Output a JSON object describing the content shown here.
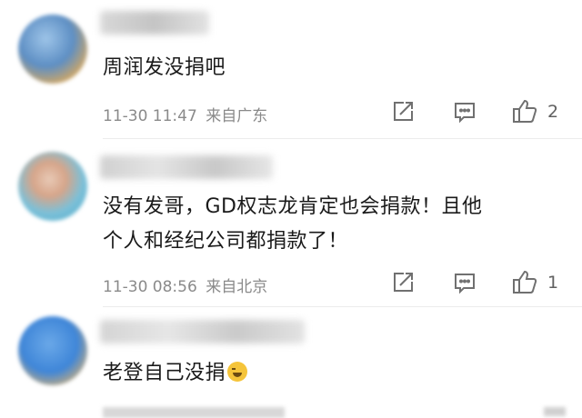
{
  "comments": [
    {
      "text": "周润发没捐吧",
      "time": "11-30 11:47",
      "location": "来自广东",
      "likes": "2"
    },
    {
      "text_line1": "没有发哥，GD权志龙肯定也会捐款！且他",
      "text_line2": "个人和经纪公司都捐款了！",
      "time": "11-30 08:56",
      "location": "来自北京",
      "likes": "1"
    },
    {
      "text": "老登自己没捐",
      "emoji": "laugh-cry-emoji"
    }
  ],
  "icons": {
    "share": "share-icon",
    "reply": "comment-icon",
    "like": "thumbs-up-icon"
  }
}
